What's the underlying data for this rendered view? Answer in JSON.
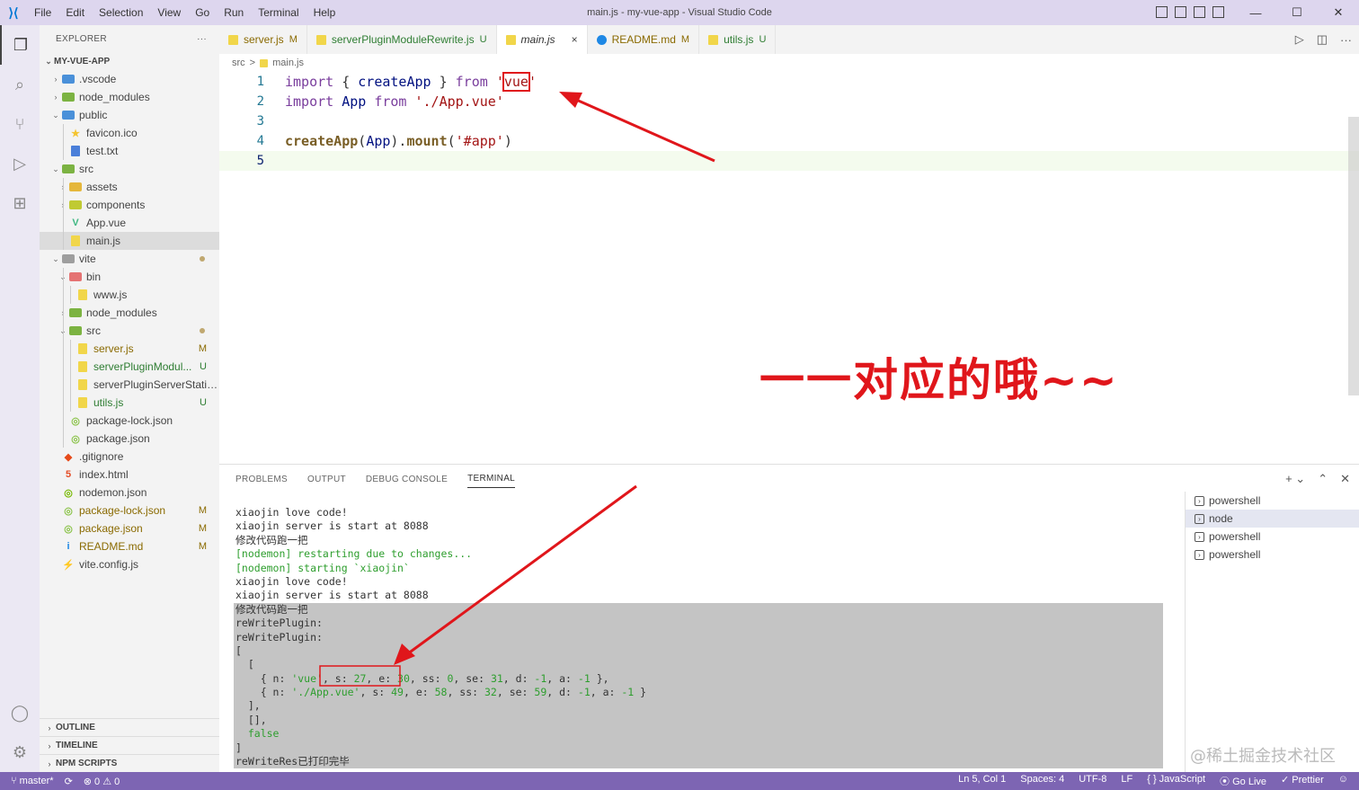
{
  "titlebar": {
    "menu": [
      "File",
      "Edit",
      "Selection",
      "View",
      "Go",
      "Run",
      "Terminal",
      "Help"
    ],
    "title": "main.js - my-vue-app - Visual Studio Code"
  },
  "sidebar": {
    "header": "EXPLORER",
    "more": "···",
    "root": "MY-VUE-APP",
    "tree": [
      {
        "label": ".vscode",
        "depth": 1,
        "kind": "folder",
        "open": false,
        "color": "#4a90d9"
      },
      {
        "label": "node_modules",
        "depth": 1,
        "kind": "folder",
        "open": false,
        "color": "#7cb342"
      },
      {
        "label": "public",
        "depth": 1,
        "kind": "folder",
        "open": true,
        "color": "#4a90d9"
      },
      {
        "label": "favicon.ico",
        "depth": 2,
        "kind": "file",
        "color": "#f4c430",
        "glyph": "★"
      },
      {
        "label": "test.txt",
        "depth": 2,
        "kind": "file",
        "color": "#4a7fd9"
      },
      {
        "label": "src",
        "depth": 1,
        "kind": "folder",
        "open": true,
        "color": "#7cb342"
      },
      {
        "label": "assets",
        "depth": 2,
        "kind": "folder",
        "open": false,
        "color": "#e5b73b"
      },
      {
        "label": "components",
        "depth": 2,
        "kind": "folder",
        "open": false,
        "color": "#c0ca33"
      },
      {
        "label": "App.vue",
        "depth": 2,
        "kind": "file",
        "color": "#41b883",
        "glyph": "V"
      },
      {
        "label": "main.js",
        "depth": 2,
        "kind": "file",
        "color": "#f1d64a",
        "selected": true
      },
      {
        "label": "vite",
        "depth": 1,
        "kind": "folder",
        "open": true,
        "color": "#9e9e9e",
        "dot": true
      },
      {
        "label": "bin",
        "depth": 2,
        "kind": "folder",
        "open": true,
        "color": "#e57373"
      },
      {
        "label": "www.js",
        "depth": 3,
        "kind": "file",
        "color": "#f1d64a"
      },
      {
        "label": "node_modules",
        "depth": 2,
        "kind": "folder",
        "open": false,
        "color": "#7cb342"
      },
      {
        "label": "src",
        "depth": 2,
        "kind": "folder",
        "open": true,
        "color": "#7cb342",
        "dot": true
      },
      {
        "label": "server.js",
        "depth": 3,
        "kind": "file",
        "color": "#f1d64a",
        "status": "M"
      },
      {
        "label": "serverPluginModul...",
        "depth": 3,
        "kind": "file",
        "color": "#f1d64a",
        "status": "U"
      },
      {
        "label": "serverPluginServerStatic...",
        "depth": 3,
        "kind": "file",
        "color": "#f1d64a"
      },
      {
        "label": "utils.js",
        "depth": 3,
        "kind": "file",
        "color": "#f1d64a",
        "status": "U"
      },
      {
        "label": "package-lock.json",
        "depth": 2,
        "kind": "file",
        "color": "#8bc34a",
        "glyph": "◎"
      },
      {
        "label": "package.json",
        "depth": 2,
        "kind": "file",
        "color": "#8bc34a",
        "glyph": "◎"
      },
      {
        "label": ".gitignore",
        "depth": 1,
        "kind": "file",
        "color": "#e64a19",
        "glyph": "◆"
      },
      {
        "label": "index.html",
        "depth": 1,
        "kind": "file",
        "color": "#e44d26",
        "glyph": "5"
      },
      {
        "label": "nodemon.json",
        "depth": 1,
        "kind": "file",
        "color": "#76b900",
        "glyph": "◎"
      },
      {
        "label": "package-lock.json",
        "depth": 1,
        "kind": "file",
        "color": "#8bc34a",
        "glyph": "◎",
        "status": "M"
      },
      {
        "label": "package.json",
        "depth": 1,
        "kind": "file",
        "color": "#8bc34a",
        "glyph": "◎",
        "status": "M"
      },
      {
        "label": "README.md",
        "depth": 1,
        "kind": "file",
        "color": "#1e88e5",
        "glyph": "i",
        "status": "M"
      },
      {
        "label": "vite.config.js",
        "depth": 1,
        "kind": "file",
        "color": "#ffc107",
        "glyph": "⚡"
      }
    ],
    "sections": [
      "OUTLINE",
      "TIMELINE",
      "NPM SCRIPTS"
    ]
  },
  "tabs": [
    {
      "label": "server.js",
      "status": "M",
      "icon_color": "#f1d64a"
    },
    {
      "label": "serverPluginModuleRewrite.js",
      "status": "U",
      "icon_color": "#f1d64a"
    },
    {
      "label": "main.js",
      "status": "",
      "icon_color": "#f1d64a",
      "active": true,
      "close": "×"
    },
    {
      "label": "README.md",
      "status": "M",
      "icon_color": "#1e88e5"
    },
    {
      "label": "utils.js",
      "status": "U",
      "icon_color": "#f1d64a"
    }
  ],
  "breadcrumb": {
    "folder": "src",
    "sep": ">",
    "file": "main.js"
  },
  "editor": {
    "line_numbers": [
      "1",
      "2",
      "3",
      "4",
      "5"
    ]
  },
  "annotation_text": "一一对应的哦~~",
  "panel": {
    "tabs": [
      "PROBLEMS",
      "OUTPUT",
      "DEBUG CONSOLE",
      "TERMINAL"
    ],
    "active_tab": "TERMINAL",
    "terminals": [
      "powershell",
      "node",
      "powershell",
      "powershell"
    ],
    "selected_terminal": 1
  },
  "terminal_lines": [
    "xiaojin love code!",
    "xiaojin server is start at 8088",
    "修改代码跑一把",
    "[nodemon] restarting due to changes...",
    "[nodemon] starting `xiaojin`",
    "xiaojin love code!",
    "xiaojin server is start at 8088",
    "修改代码跑一把",
    "reWritePlugin:",
    "reWritePlugin:",
    "[",
    "  [",
    "    { n: 'vue', s: 27, e: 30, ss: 0, se: 31, d: -1, a: -1 },",
    "    { n: './App.vue', s: 49, e: 58, ss: 32, se: 59, d: -1, a: -1 }",
    "  ],",
    "  [],",
    "  false",
    "]",
    "reWriteRes已打印完毕"
  ],
  "watermark": "@稀土掘金技术社区",
  "statusbar": {
    "branch": "master*",
    "sync": "⟳",
    "errors": "⊗ 0",
    "warnings": "⚠ 0",
    "position": "Ln 5, Col 1",
    "spaces": "Spaces: 4",
    "encoding": "UTF-8",
    "eol": "LF",
    "language": "{ } JavaScript",
    "golive": "Go Live",
    "prettier": "✓ Prettier",
    "feedback": "☺"
  },
  "colors": {
    "accent": "#7d65b3",
    "annotation": "#e0161b"
  }
}
